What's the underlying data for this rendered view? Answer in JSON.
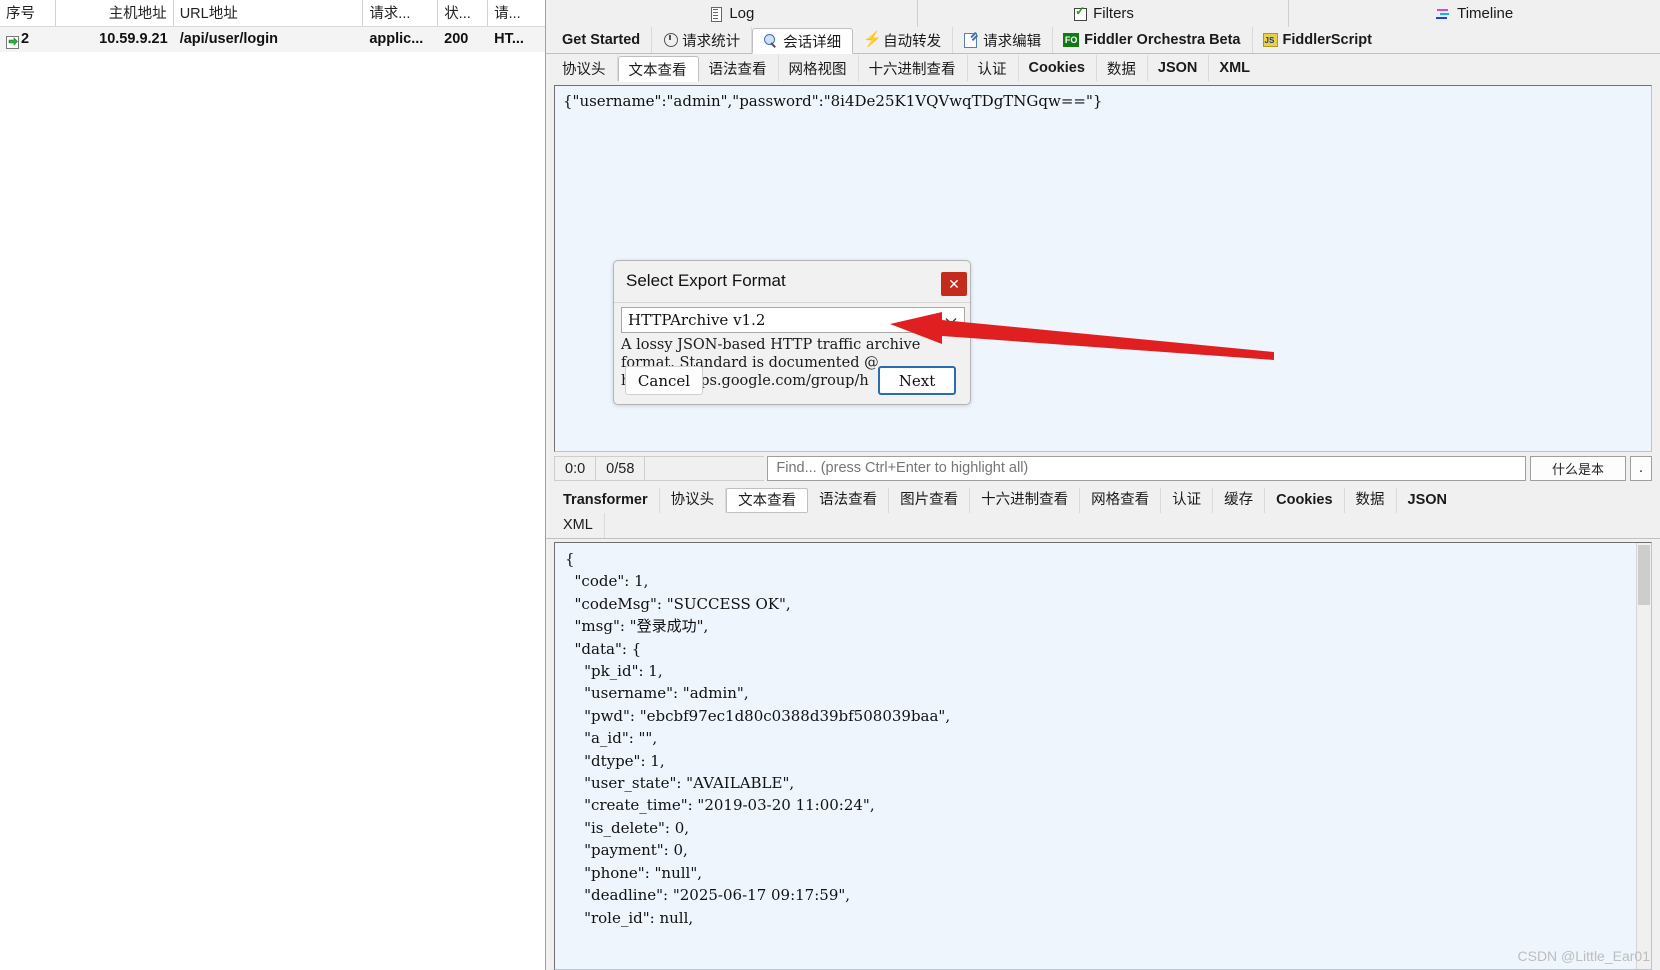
{
  "session_grid": {
    "columns": [
      "序号",
      "主机地址",
      "URL地址",
      "请求...",
      "状...",
      "请..."
    ],
    "rows": [
      {
        "icon": "response-arrow-icon",
        "index": "2",
        "host": "10.59.9.21",
        "url": "/api/user/login",
        "content_type": "applic...",
        "status": "200",
        "protocol": "HT..."
      }
    ]
  },
  "top_tabs": [
    {
      "label": "Log",
      "icon": "log-icon"
    },
    {
      "label": "Filters",
      "icon": "filters-checkbox-icon"
    },
    {
      "label": "Timeline",
      "icon": "timeline-icon"
    }
  ],
  "inspector_tabs": [
    {
      "label": "Get Started",
      "icon": "",
      "active": false
    },
    {
      "label": "请求统计",
      "icon": "statistics-icon",
      "active": false
    },
    {
      "label": "会话详细",
      "icon": "inspect-magnifier-icon",
      "active": true
    },
    {
      "label": "自动转发",
      "icon": "bolt-icon",
      "active": false
    },
    {
      "label": "请求编辑",
      "icon": "compose-pencil-icon",
      "active": false
    },
    {
      "label": "Fiddler Orchestra Beta",
      "icon": "orchestra-icon",
      "active": false
    },
    {
      "label": "FiddlerScript",
      "icon": "fiddlerscript-icon",
      "active": false
    }
  ],
  "request_tabs": [
    {
      "label": "协议头",
      "active": false,
      "bold": false
    },
    {
      "label": "文本查看",
      "active": true,
      "bold": false
    },
    {
      "label": "语法查看",
      "active": false,
      "bold": false
    },
    {
      "label": "网格视图",
      "active": false,
      "bold": false
    },
    {
      "label": "十六进制查看",
      "active": false,
      "bold": false
    },
    {
      "label": "认证",
      "active": false,
      "bold": false
    },
    {
      "label": "Cookies",
      "active": false,
      "bold": true
    },
    {
      "label": "数据",
      "active": false,
      "bold": false
    },
    {
      "label": "JSON",
      "active": false,
      "bold": true
    },
    {
      "label": "XML",
      "active": false,
      "bold": true
    }
  ],
  "request_body": {
    "text": "{\"username\":\"admin\",\"password\":\"8i4De25K1VQVwqTDgTNGqw==\"}"
  },
  "find_bar": {
    "position": "0:0",
    "match_count": "0/58",
    "placeholder": "Find... (press Ctrl+Enter to highlight all)",
    "value": "",
    "view_button": "什么是本",
    "dots_button": "."
  },
  "response_tabs": [
    {
      "label": "Transformer",
      "active": false,
      "bold": true
    },
    {
      "label": "协议头",
      "active": false,
      "bold": false
    },
    {
      "label": "文本查看",
      "active": true,
      "bold": false
    },
    {
      "label": "语法查看",
      "active": false,
      "bold": false
    },
    {
      "label": "图片查看",
      "active": false,
      "bold": false
    },
    {
      "label": "十六进制查看",
      "active": false,
      "bold": false
    },
    {
      "label": "网格查看",
      "active": false,
      "bold": false
    },
    {
      "label": "认证",
      "active": false,
      "bold": false
    },
    {
      "label": "缓存",
      "active": false,
      "bold": false
    },
    {
      "label": "Cookies",
      "active": false,
      "bold": true
    },
    {
      "label": "数据",
      "active": false,
      "bold": false
    },
    {
      "label": "JSON",
      "active": false,
      "bold": true
    },
    {
      "label": "XML",
      "active": false,
      "bold": false
    }
  ],
  "response_body": {
    "text": "{\n  \"code\": 1,\n  \"codeMsg\": \"SUCCESS OK\",\n  \"msg\": \"登录成功\",\n  \"data\": {\n    \"pk_id\": 1,\n    \"username\": \"admin\",\n    \"pwd\": \"ebcbf97ec1d80c0388d39bf508039baa\",\n    \"a_id\": \"\",\n    \"dtype\": 1,\n    \"user_state\": \"AVAILABLE\",\n    \"create_time\": \"2019-03-20 11:00:24\",\n    \"is_delete\": 0,\n    \"payment\": 0,\n    \"phone\": \"null\",\n    \"deadline\": \"2025-06-17 09:17:59\",\n    \"role_id\": null,"
  },
  "dialog": {
    "title": "Select Export Format",
    "close_label": "✕",
    "combo_value": "HTTPArchive v1.2",
    "description": "A lossy JSON-based HTTP traffic archive\nformat. Standard is documented @\nhttp://groups.google.com/group/h",
    "cancel_label": "Cancel",
    "next_label": "Next"
  },
  "annotation": {
    "arrow_color": "#e02020"
  },
  "watermark": "CSDN @Little_Ear01"
}
